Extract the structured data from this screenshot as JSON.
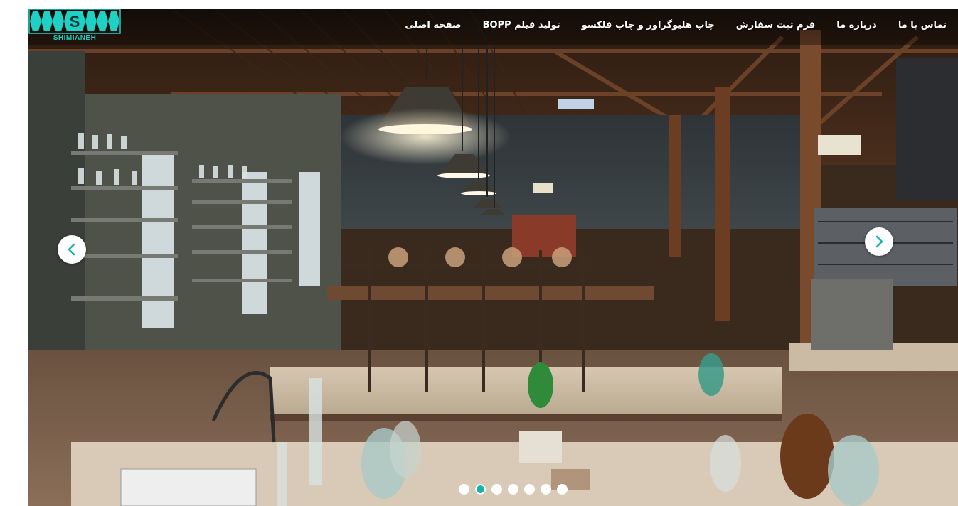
{
  "brand": {
    "name": "SHIMIANEH",
    "color": "#1fd0c4"
  },
  "nav": {
    "items": [
      {
        "label": "صفحه اصلی"
      },
      {
        "label": "تولید فیلم BOPP"
      },
      {
        "label": "چاپ هلیوگراور و  چاپ فلکسو"
      },
      {
        "label": "فرم ثبت سفارش"
      },
      {
        "label": "درباره ما"
      },
      {
        "label": "تماس با ما"
      }
    ]
  },
  "slider": {
    "image_description_icon": "laboratory-photo",
    "prev_icon": "chevron-left-icon",
    "next_icon": "chevron-right-icon",
    "arrow_color": "#16b5a6",
    "active_dot_color": "#16b5a6",
    "dot_count": 7,
    "active_index": 1
  }
}
